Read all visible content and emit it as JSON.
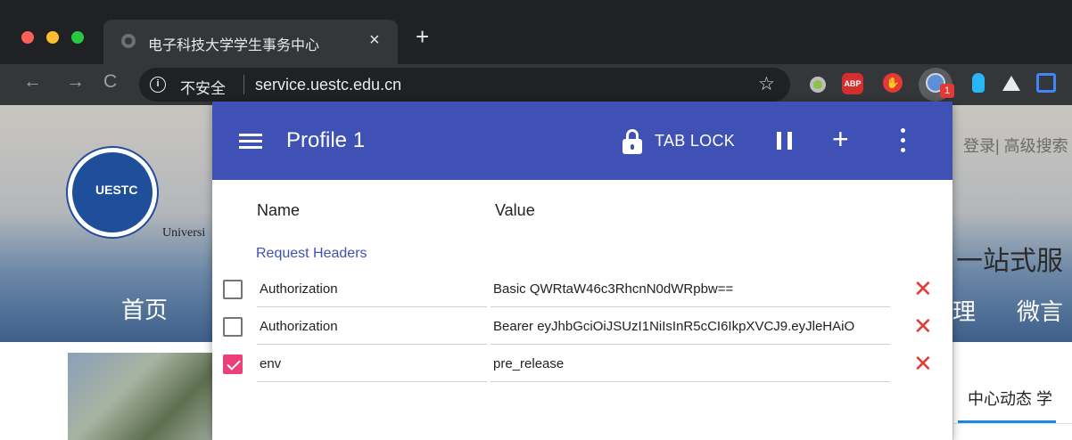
{
  "browser": {
    "tab_title": "电子科技大学学生事务中心",
    "tab_close": "×",
    "new_tab": "+",
    "security_label": "不安全",
    "url": "service.uestc.edu.cn",
    "extension_badge": "1",
    "abp_label": "ABP"
  },
  "page": {
    "university_text": "Universi",
    "nav_home": "首页",
    "login_links": "登录|  高级搜索",
    "slogan": "一站式服",
    "nav_right_1": "理",
    "nav_right_2": "微言",
    "right_tab": "中心动态  学"
  },
  "popup": {
    "profile_title": "Profile 1",
    "tab_lock_label": "TAB LOCK",
    "column_name": "Name",
    "column_value": "Value",
    "section_title": "Request Headers",
    "headers": [
      {
        "enabled": false,
        "name": "Authorization",
        "value": "Basic QWRtaW46c3RhcnN0dWRpbw=="
      },
      {
        "enabled": false,
        "name": "Authorization",
        "value": "Bearer eyJhbGciOiJSUzI1NiIsInR5cCI6IkpXVCJ9.eyJleHAiO"
      },
      {
        "enabled": true,
        "name": "env",
        "value": "pre_release"
      }
    ]
  },
  "colors": {
    "popup_bar": "#3f51b5",
    "checkbox_checked": "#ec407a",
    "delete_icon": "#e53935"
  }
}
